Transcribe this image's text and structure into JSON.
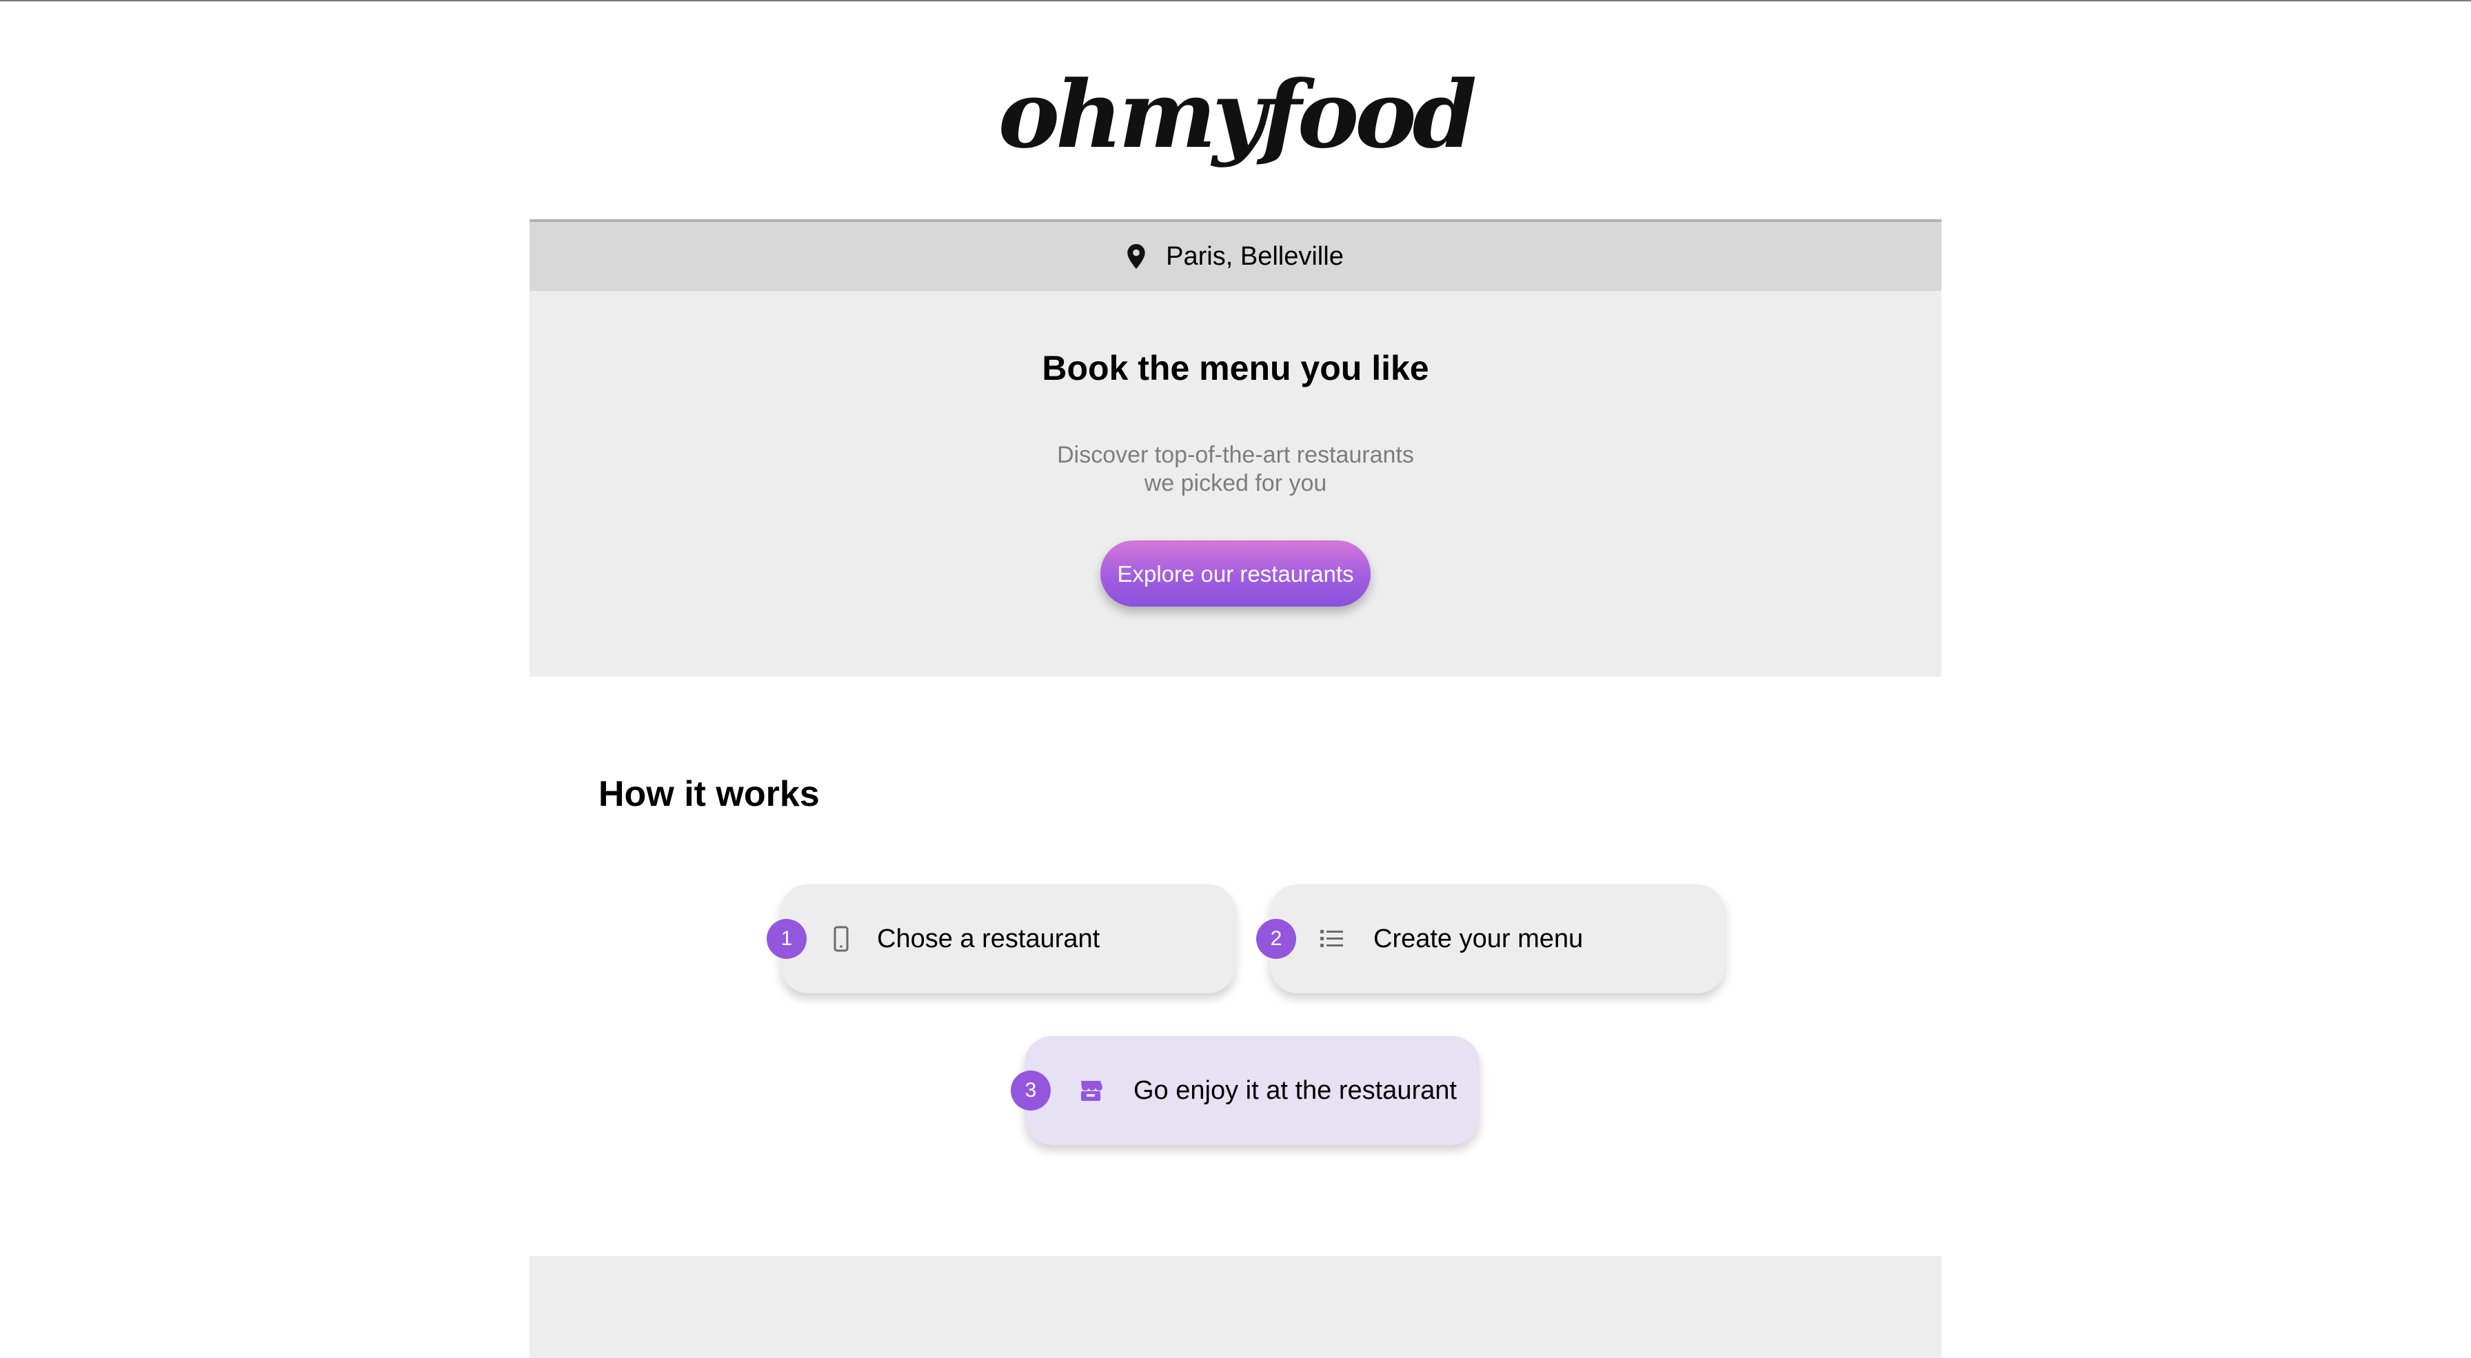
{
  "brand": {
    "logo_text": "ohmyfood"
  },
  "location": {
    "icon": "map-pin-icon",
    "text": "Paris, Belleville"
  },
  "hero": {
    "title": "Book the menu you like",
    "subtitle_line1": "Discover top-of-the-art restaurants",
    "subtitle_line2": "we picked for you",
    "cta_label": "Explore our restaurants"
  },
  "how_it_works": {
    "title": "How it works",
    "steps": [
      {
        "number": "1",
        "icon": "mobile-phone-icon",
        "label": "Chose a restaurant"
      },
      {
        "number": "2",
        "icon": "list-icon",
        "label": "Create your menu"
      },
      {
        "number": "3",
        "icon": "store-icon",
        "label": "Go enjoy it at the restaurant"
      }
    ]
  },
  "colors": {
    "accent": "#9356dc",
    "button_gradient_start": "#d477d9",
    "button_gradient_end": "#8a52dc",
    "section_bg": "#eeedee",
    "location_bar_bg": "#d9d8d9",
    "highlight_card_bg": "#e6e1f3"
  }
}
